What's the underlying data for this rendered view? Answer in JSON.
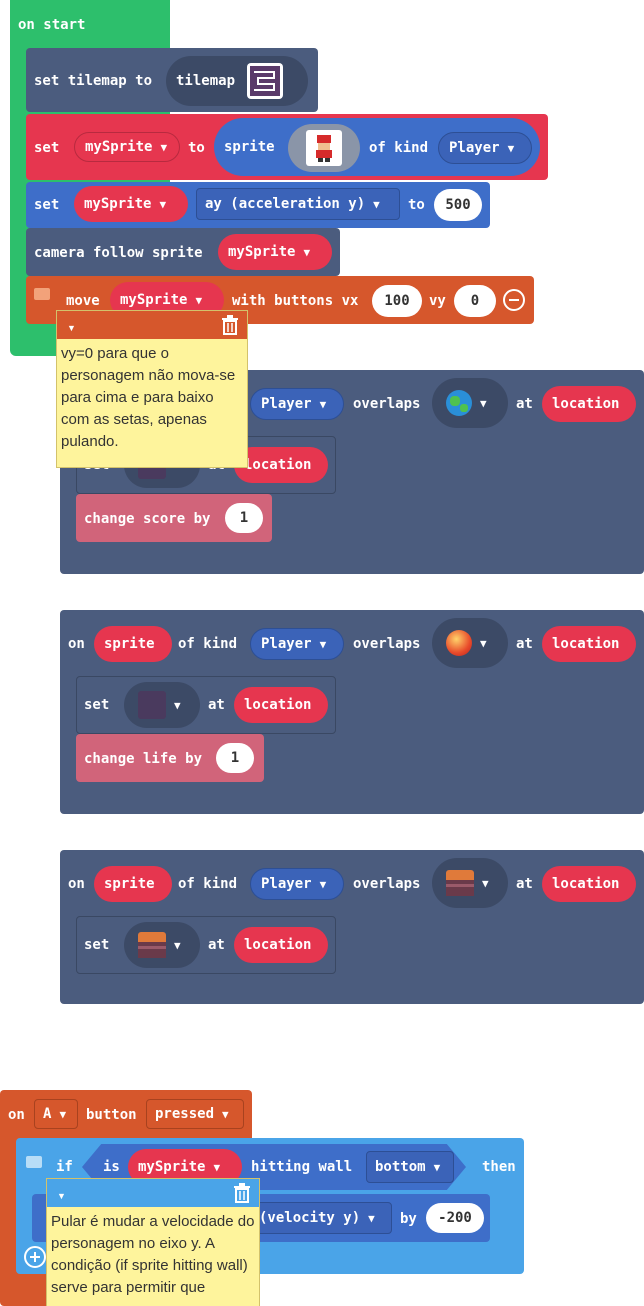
{
  "colors": {
    "green": "#2dbf6c",
    "slate": "#4b5c7e",
    "red": "#e6364f",
    "blue": "#3e6ec9",
    "orange": "#d6572c",
    "pink": "#d1647a",
    "lightblue": "#4aa4e8",
    "comment": "#fef49c"
  },
  "on_start": {
    "hat": "on start",
    "set_tilemap": {
      "set": "set tilemap to",
      "value": "tilemap"
    },
    "set_sprite": {
      "set": "set",
      "var": "mySprite",
      "to": "to",
      "sprite": "sprite",
      "of_kind": "of kind",
      "kind": "Player"
    },
    "set_ay": {
      "set": "set",
      "var": "mySprite",
      "prop": "ay (acceleration y)",
      "to": "to",
      "value": "500"
    },
    "camera": {
      "label": "camera follow sprite",
      "var": "mySprite"
    },
    "move": {
      "move": "move",
      "var": "mySprite",
      "with": "with buttons vx",
      "vx": "100",
      "vy_label": "vy",
      "vy": "0"
    },
    "comment": "vy=0 para que o personagem não mova-se para cima e para baixo com as setas, apenas pulando."
  },
  "overlap1": {
    "kind": "Player",
    "overlaps": "overlaps",
    "at": "at",
    "location": "location",
    "set": "set",
    "set_at": "at",
    "set_location": "location",
    "change": "change score by",
    "change_value": "1"
  },
  "overlap2": {
    "on": "on",
    "sprite": "sprite",
    "of_kind": "of kind",
    "kind": "Player",
    "overlaps": "overlaps",
    "at": "at",
    "location": "location",
    "set": "set",
    "set_at": "at",
    "set_location": "location",
    "change": "change life by",
    "change_value": "1"
  },
  "overlap3": {
    "on": "on",
    "sprite": "sprite",
    "of_kind": "of kind",
    "kind": "Player",
    "overlaps": "overlaps",
    "at": "at",
    "location": "location",
    "set": "set",
    "set_at": "at",
    "set_location": "location"
  },
  "button_event": {
    "on": "on",
    "button": "A",
    "button_label": "button",
    "action": "pressed",
    "if": "if",
    "is": "is",
    "var": "mySprite",
    "hitting": "hitting wall",
    "side": "bottom",
    "then": "then",
    "change_prop": "(velocity y)",
    "by": "by",
    "value": "-200",
    "comment": "Pular é mudar a velocidade do personagem no eixo y. A condição (if sprite hitting wall) serve para permitir que"
  }
}
